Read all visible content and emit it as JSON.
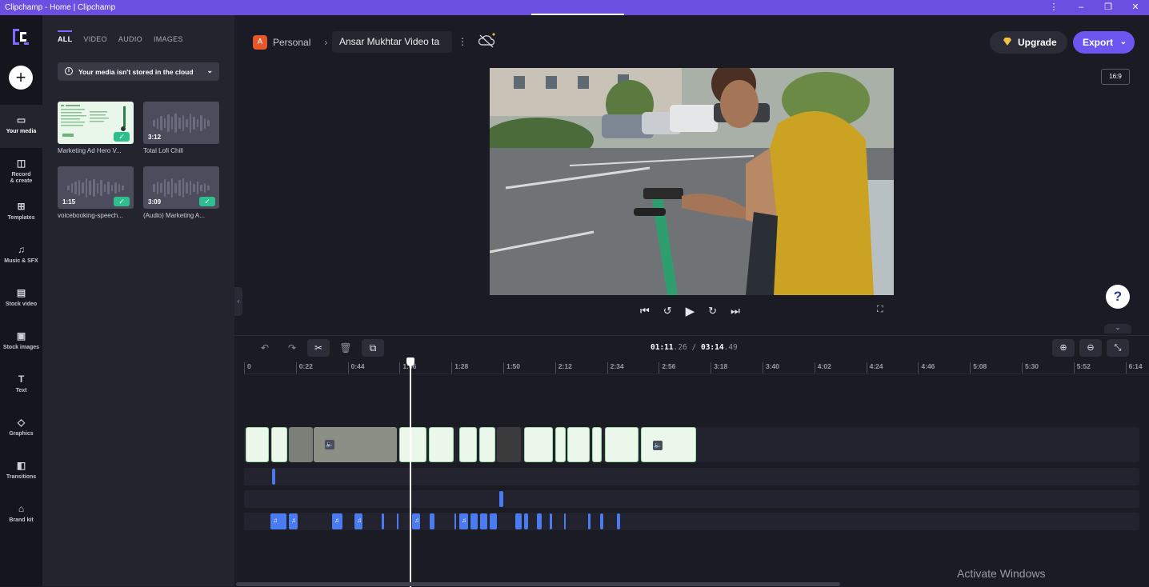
{
  "window": {
    "title": "Clipchamp - Home | Clipchamp"
  },
  "rail": {
    "items": [
      {
        "label": "Your media",
        "icon": "folder-icon"
      },
      {
        "label": "Record & create",
        "icon": "camera-icon"
      },
      {
        "label": "Templates",
        "icon": "templates-icon"
      },
      {
        "label": "Music & SFX",
        "icon": "music-icon"
      },
      {
        "label": "Stock video",
        "icon": "film-icon"
      },
      {
        "label": "Stock images",
        "icon": "image-icon"
      },
      {
        "label": "Text",
        "icon": "text-icon"
      },
      {
        "label": "Graphics",
        "icon": "shapes-icon"
      },
      {
        "label": "Transitions",
        "icon": "transitions-icon"
      },
      {
        "label": "Brand kit",
        "icon": "brand-icon"
      }
    ]
  },
  "media": {
    "tabs": [
      "ALL",
      "VIDEO",
      "AUDIO",
      "IMAGES"
    ],
    "active_tab": "ALL",
    "cloud_notice": "Your media isn't stored in the cloud",
    "items": [
      {
        "name": "Marketing Ad Hero V...",
        "duration": "",
        "kind": "doc",
        "added": true
      },
      {
        "name": "Total Lofi Chill",
        "duration": "3:12",
        "kind": "audio",
        "added": false
      },
      {
        "name": "voicebooking-speech...",
        "duration": "1:15",
        "kind": "audio",
        "added": true
      },
      {
        "name": "(Audio) Marketing A...",
        "duration": "3:09",
        "kind": "audio",
        "added": true
      }
    ]
  },
  "header": {
    "workspace_initial": "A",
    "workspace": "Personal",
    "project_name": "Ansar Mukhtar Video ta",
    "upgrade_label": "Upgrade",
    "export_label": "Export",
    "aspect_ratio": "16:9"
  },
  "timeline": {
    "current": "01:11",
    "current_frac": ".26",
    "separator": "/",
    "total": "03:14",
    "total_frac": ".49",
    "ruler": [
      "0",
      "0:22",
      "0:44",
      "1:06",
      "1:28",
      "1:50",
      "2:12",
      "2:34",
      "2:56",
      "3:18",
      "3:40",
      "4:02",
      "4:24",
      "4:46",
      "5:08",
      "5:30",
      "5:52",
      "6:14"
    ]
  },
  "watermark": "Activate Windows",
  "colors": {
    "accent": "#6b56f0",
    "titlebar": "#6b4fe0",
    "audio_clip": "#4a7bf0",
    "check": "#2fbf8f"
  }
}
